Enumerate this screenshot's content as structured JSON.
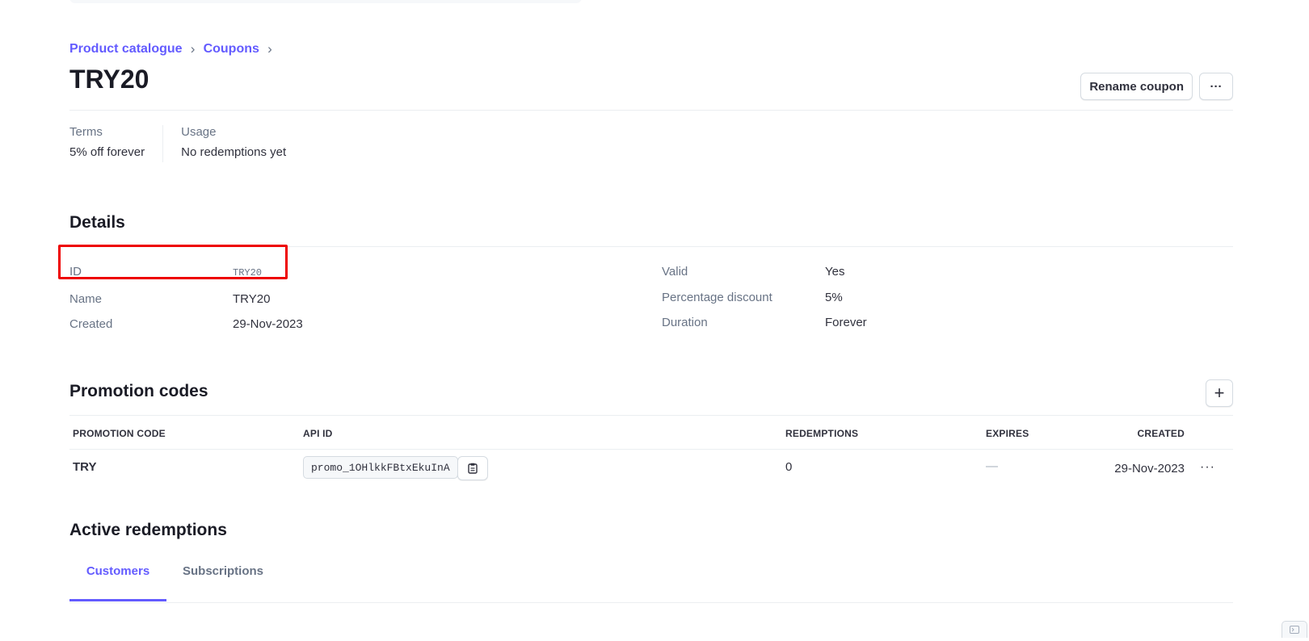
{
  "breadcrumb": {
    "items": [
      "Product catalogue",
      "Coupons"
    ]
  },
  "header": {
    "title": "TRY20",
    "rename_label": "Rename coupon",
    "more_label": "···"
  },
  "summary": {
    "terms_label": "Terms",
    "terms_value": "5% off forever",
    "usage_label": "Usage",
    "usage_value": "No redemptions yet"
  },
  "details": {
    "title": "Details",
    "left": [
      {
        "label": "ID",
        "value": "TRY20"
      },
      {
        "label": "Name",
        "value": "TRY20"
      },
      {
        "label": "Created",
        "value": "29-Nov-2023"
      }
    ],
    "right": [
      {
        "label": "Valid",
        "value": "Yes"
      },
      {
        "label": "Percentage discount",
        "value": "5%"
      },
      {
        "label": "Duration",
        "value": "Forever"
      }
    ]
  },
  "promotion_codes": {
    "title": "Promotion codes",
    "add_label": "+",
    "columns": [
      "PROMOTION CODE",
      "API ID",
      "REDEMPTIONS",
      "EXPIRES",
      "CREATED"
    ],
    "rows": [
      {
        "code": "TRY",
        "api_id": "promo_1OHlkkFBtxEkuInA",
        "redemptions": "0",
        "expires": "—",
        "created": "29-Nov-2023",
        "more": "···"
      }
    ]
  },
  "active_redemptions": {
    "title": "Active redemptions",
    "tabs": [
      "Customers",
      "Subscriptions"
    ],
    "active_tab": "Customers"
  },
  "colors": {
    "accent": "#635bff",
    "highlight": "#ee0000",
    "text_primary": "#1a1b25",
    "text_secondary": "#687385"
  },
  "icons": {
    "breadcrumb_separator": "chevron-right-icon",
    "copy": "clipboard-icon",
    "more": "ellipsis-icon",
    "add": "plus-icon",
    "corner": "terminal-icon"
  }
}
